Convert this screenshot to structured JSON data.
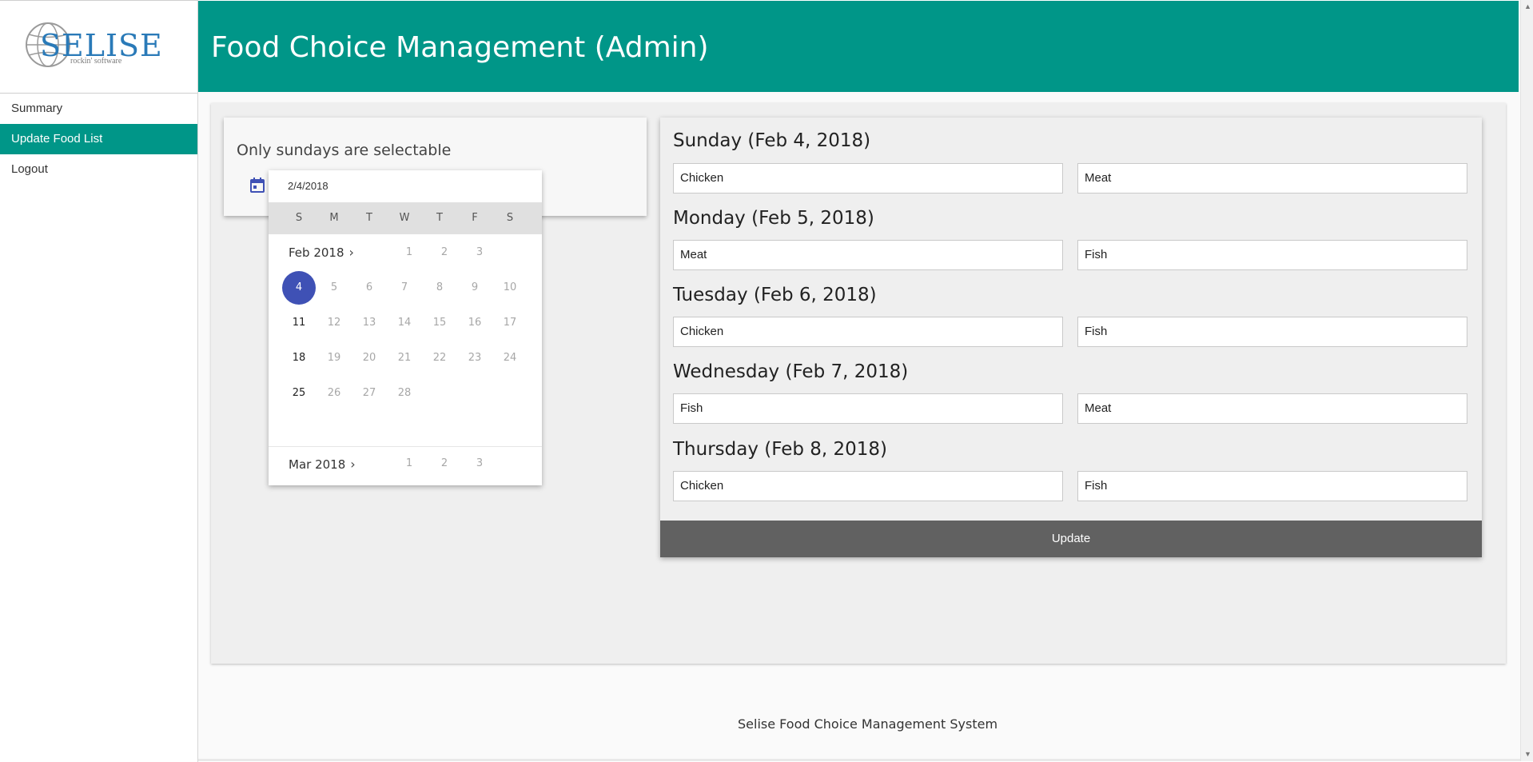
{
  "logo": {
    "name": "SELISE",
    "tagline": "rockin' software"
  },
  "header": {
    "title": "Food Choice Management (Admin)"
  },
  "sidebar": {
    "items": [
      {
        "label": "Summary",
        "active": false
      },
      {
        "label": "Update Food List",
        "active": true
      },
      {
        "label": "Logout",
        "active": false
      }
    ]
  },
  "picker": {
    "label": "Only sundays are selectable",
    "value": "2/4/2018",
    "weekdays": [
      "S",
      "M",
      "T",
      "W",
      "T",
      "F",
      "S"
    ],
    "month1": {
      "label": "Feb 2018",
      "first_week": [
        "1",
        "2",
        "3"
      ]
    },
    "weeks": [
      [
        "4",
        "5",
        "6",
        "7",
        "8",
        "9",
        "10"
      ],
      [
        "11",
        "12",
        "13",
        "14",
        "15",
        "16",
        "17"
      ],
      [
        "18",
        "19",
        "20",
        "21",
        "22",
        "23",
        "24"
      ],
      [
        "25",
        "26",
        "27",
        "28"
      ]
    ],
    "selected_day": "4",
    "month2": {
      "label": "Mar 2018",
      "first_week": [
        "1",
        "2",
        "3"
      ]
    }
  },
  "menu": {
    "days": [
      {
        "title": "Sunday (Feb 4, 2018)",
        "choice1": "Chicken",
        "choice2": "Meat"
      },
      {
        "title": "Monday (Feb 5, 2018)",
        "choice1": "Meat",
        "choice2": "Fish"
      },
      {
        "title": "Tuesday (Feb 6, 2018)",
        "choice1": "Chicken",
        "choice2": "Fish"
      },
      {
        "title": "Wednesday (Feb 7, 2018)",
        "choice1": "Fish",
        "choice2": "Meat"
      },
      {
        "title": "Thursday (Feb 8, 2018)",
        "choice1": "Chicken",
        "choice2": "Fish"
      }
    ],
    "update_label": "Update"
  },
  "footer": {
    "text": "Selise Food Choice Management System"
  },
  "colors": {
    "primary": "#009688",
    "selected": "#3f51b5",
    "button": "#616161"
  },
  "icons": {
    "calendar": "calendar-icon",
    "chevron": "chevron-right-icon",
    "logo": "globe-logo-icon"
  }
}
